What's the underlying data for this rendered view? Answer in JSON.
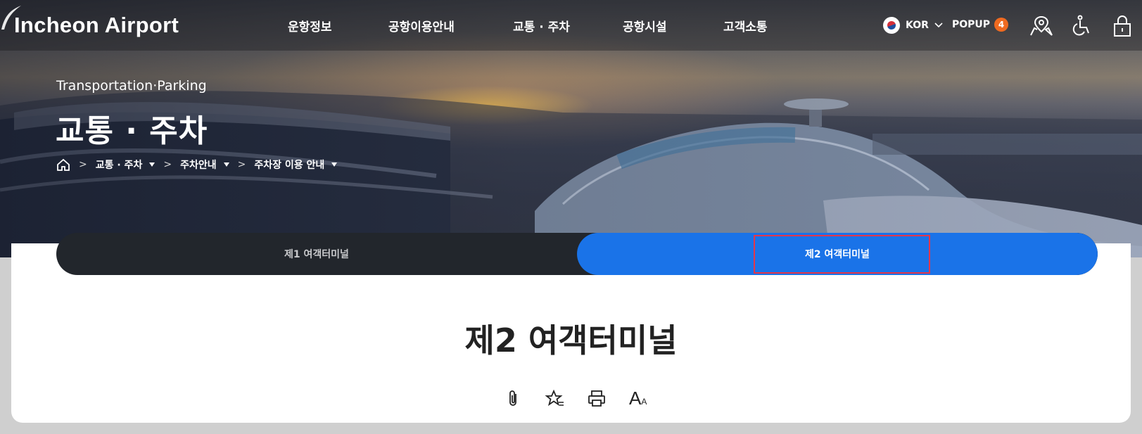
{
  "header": {
    "logo": "Incheon Airport",
    "nav": [
      "운항정보",
      "공항이용안내",
      "교통 · 주차",
      "공항시설",
      "고객소통"
    ],
    "lang": "KOR",
    "popup_label": "POPUP",
    "popup_count": "4",
    "icons": [
      "map-pin-icon",
      "wheelchair-icon",
      "lock-icon"
    ]
  },
  "hero": {
    "subtitle": "Transportation·Parking",
    "title": "교통 · 주차",
    "breadcrumb": [
      "교통 · 주차",
      "주차안내",
      "주차장 이용 안내"
    ]
  },
  "tabs": [
    {
      "label": "제1 여객터미널",
      "active": false
    },
    {
      "label": "제2 여객터미널",
      "active": true
    }
  ],
  "main": {
    "heading": "제2 여객터미널",
    "tools": [
      "attach-icon",
      "favorite-icon",
      "print-icon",
      "font-size-icon"
    ],
    "font_size_large": "A",
    "font_size_small": "A"
  },
  "colors": {
    "accent": "#1a73e8",
    "tab_dark": "#22262c",
    "badge": "#ef6a20",
    "highlight": "#e5364a"
  }
}
